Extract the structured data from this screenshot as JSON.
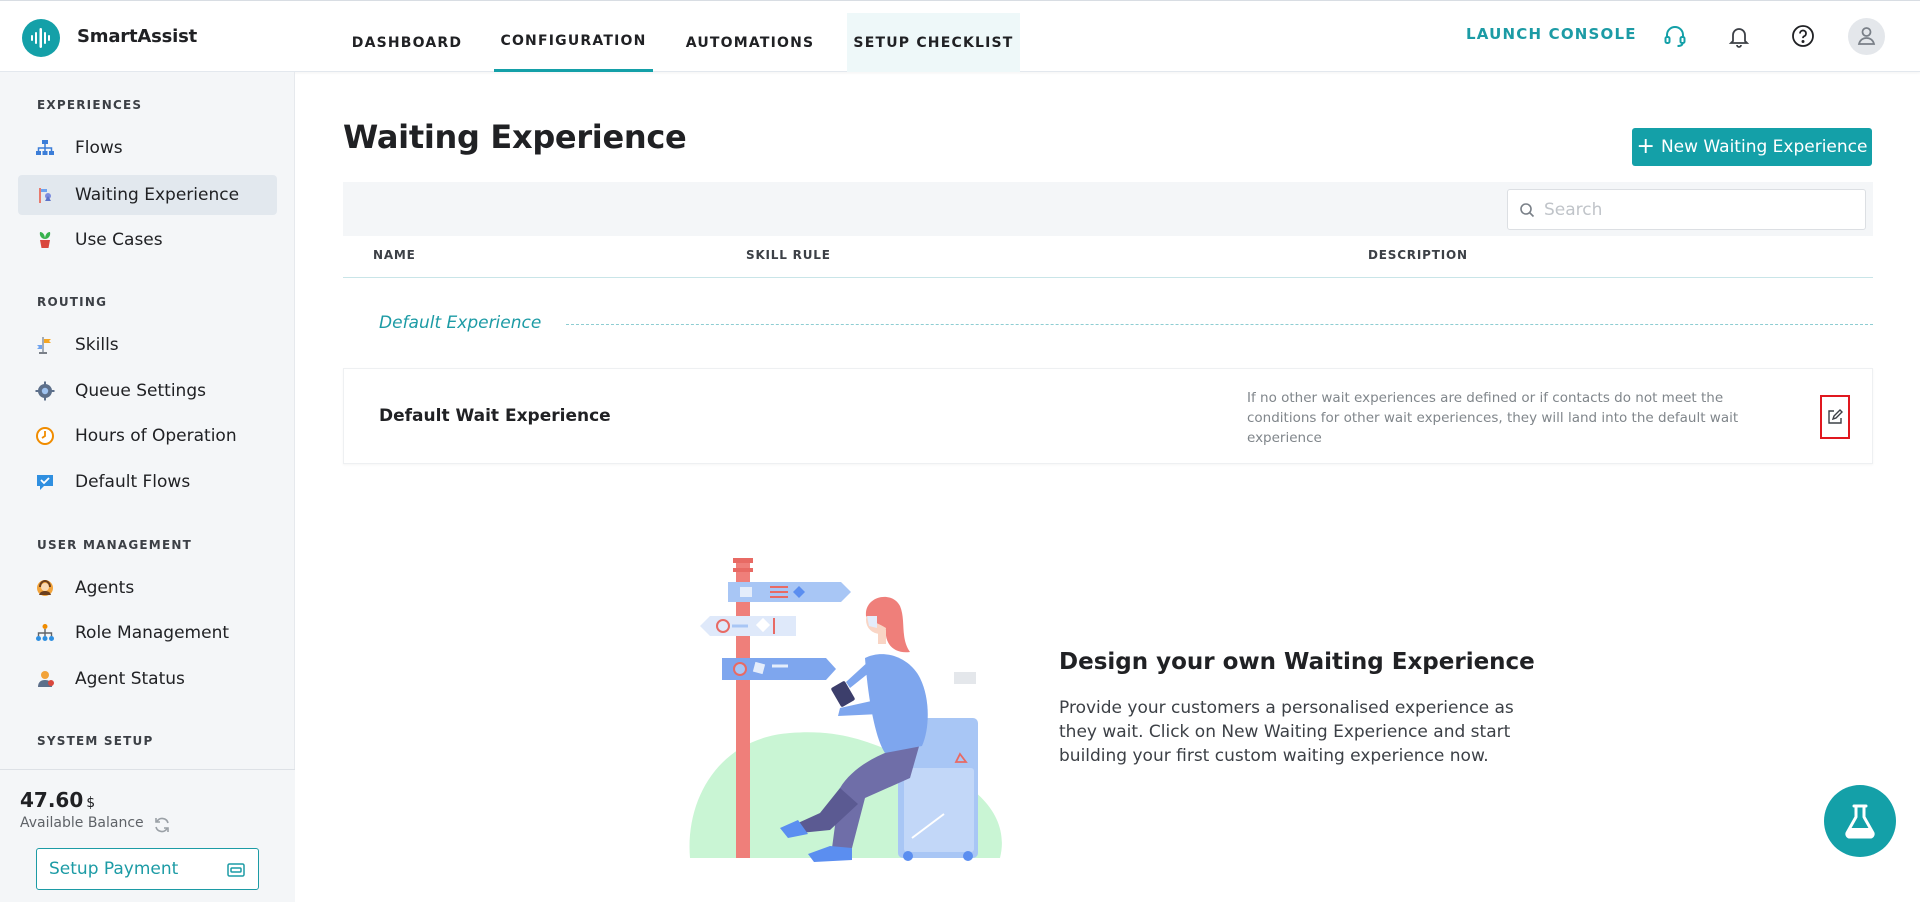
{
  "app": {
    "brand": "SmartAssist",
    "colors": {
      "accent": "#14a0a8",
      "danger": "#e0181f",
      "sidebar_bg": "#f4f6f8"
    }
  },
  "topnav": {
    "tabs": [
      {
        "label": "DASHBOARD"
      },
      {
        "label": "CONFIGURATION",
        "active": true
      },
      {
        "label": "AUTOMATIONS"
      },
      {
        "label": "SETUP CHECKLIST"
      }
    ],
    "launch_console": "LAUNCH CONSOLE",
    "icons": [
      "headset-icon",
      "bell-icon",
      "help-icon",
      "user-avatar-icon"
    ]
  },
  "sidebar": {
    "sections": [
      {
        "title": "EXPERIENCES",
        "items": [
          {
            "label": "Flows",
            "icon": "flows-icon"
          },
          {
            "label": "Waiting Experience",
            "icon": "waiting-experience-icon",
            "active": true
          },
          {
            "label": "Use Cases",
            "icon": "use-cases-icon"
          }
        ]
      },
      {
        "title": "ROUTING",
        "items": [
          {
            "label": "Skills",
            "icon": "skills-icon"
          },
          {
            "label": "Queue Settings",
            "icon": "queue-settings-icon"
          },
          {
            "label": "Hours of Operation",
            "icon": "clock-icon"
          },
          {
            "label": "Default Flows",
            "icon": "default-flows-icon"
          }
        ]
      },
      {
        "title": "USER MANAGEMENT",
        "items": [
          {
            "label": "Agents",
            "icon": "agents-icon"
          },
          {
            "label": "Role Management",
            "icon": "role-management-icon"
          },
          {
            "label": "Agent Status",
            "icon": "agent-status-icon"
          }
        ]
      },
      {
        "title": "SYSTEM SETUP",
        "items": []
      }
    ],
    "balance": {
      "value": "47.60",
      "currency": "$",
      "label": "Available Balance",
      "setup_payment": "Setup Payment"
    }
  },
  "main": {
    "title": "Waiting Experience",
    "new_button": "New Waiting Experience",
    "search_placeholder": "Search",
    "columns": [
      "NAME",
      "SKILL RULE",
      "DESCRIPTION"
    ],
    "group_label": "Default Experience",
    "rows": [
      {
        "name": "Default Wait Experience",
        "skill_rule": "",
        "description": "If no other wait experiences are defined or if contacts do not meet the conditions for other wait experiences, they will land into the default wait experience"
      }
    ],
    "empty_state": {
      "title": "Design your own Waiting Experience",
      "text": "Provide your customers a personalised experience as they wait. Click on New Waiting Experience and start building your first custom waiting experience now."
    }
  }
}
